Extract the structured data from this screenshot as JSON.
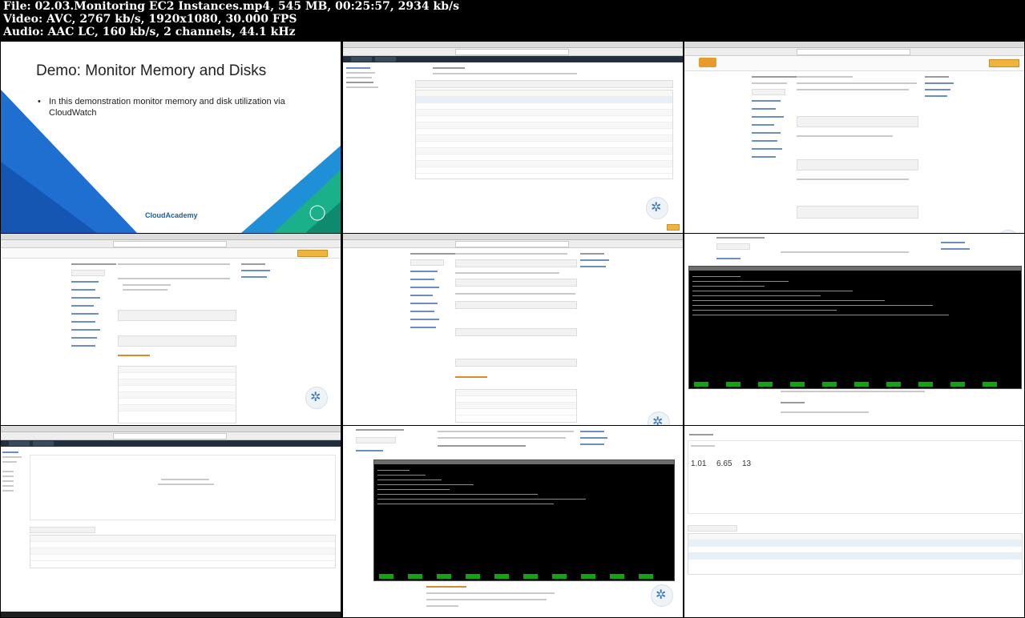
{
  "header": {
    "file": "File: 02.03.Monitoring EC2 Instances.mp4, 545 MB, 00:25:57, 2934 kb/s",
    "video": "Video: AVC, 2767 kb/s, 1920x1080, 30.000 FPS",
    "audio": "Audio: AAC LC, 160 kb/s, 2 channels, 44.1 kHz"
  },
  "tile1": {
    "title": "Demo: Monitor Memory and Disks",
    "bullet": "In this demonstration monitor memory and disk utilization via CloudWatch",
    "logo": "CloudAcademy"
  },
  "tile9": {
    "metrics": [
      "1.01",
      "6.65",
      "13"
    ]
  },
  "colors": {
    "slide_blue": "#1e6fd0",
    "slide_green": "#19b08a",
    "aws_nav": "#232f3e",
    "terminal_green": "#27d32a",
    "aws_button": "#f0b43c"
  }
}
